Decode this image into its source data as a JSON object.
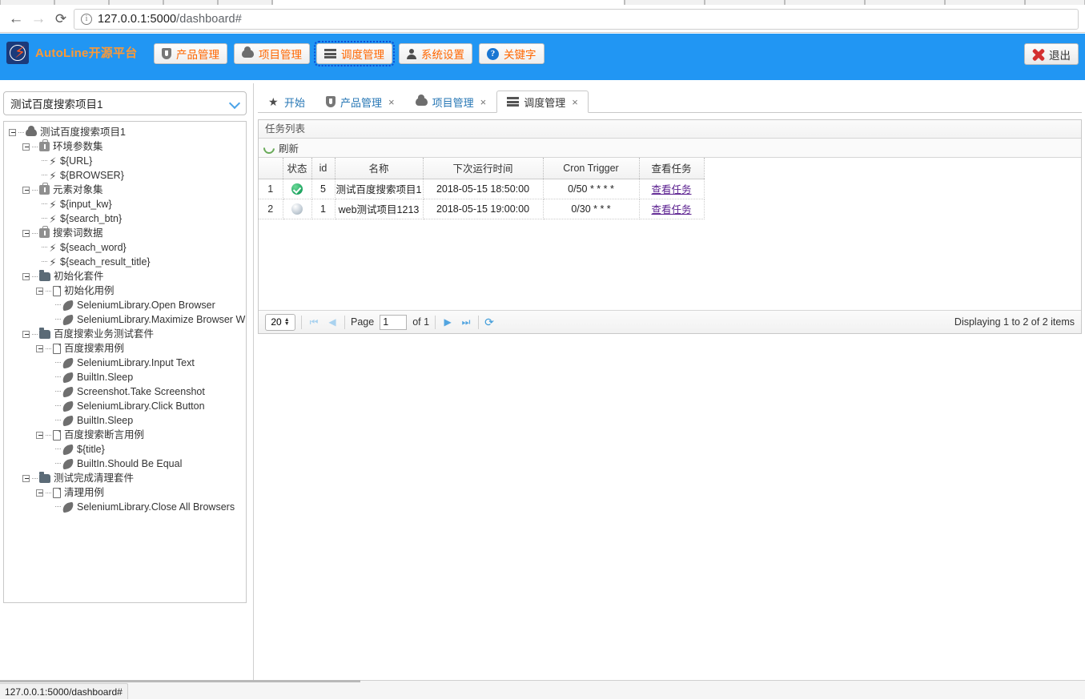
{
  "browser": {
    "back_icon": "arrow-left-icon",
    "forward_icon": "arrow-right-icon",
    "reload_icon": "reload-icon",
    "info_icon": "info-icon",
    "url_host": "127.0.0.1:5000",
    "url_path": "/dashboard#",
    "url_full": "127.0.0.1:5000/dashboard#"
  },
  "header": {
    "brand": "AutoLine开源平台",
    "logo_icon": "lightning-logo-icon",
    "nav": [
      {
        "label": "产品管理",
        "icon": "shield-icon",
        "active": false
      },
      {
        "label": "项目管理",
        "icon": "cloud-icon",
        "active": false
      },
      {
        "label": "调度管理",
        "icon": "lines-icon",
        "active": true
      },
      {
        "label": "系统设置",
        "icon": "user-icon",
        "active": false
      },
      {
        "label": "关键字",
        "icon": "help-icon",
        "active": false
      }
    ],
    "logout": {
      "label": "退出",
      "icon": "red-x-icon"
    }
  },
  "sidebar": {
    "project_select": {
      "value": "测试百度搜索项目1",
      "icon": "chevron-down-icon"
    },
    "tree": [
      {
        "label": "测试百度搜索项目1",
        "indent": 0,
        "icon": "cloud-icon",
        "toggle": true
      },
      {
        "label": "环境参数集",
        "indent": 1,
        "icon": "case-icon",
        "toggle": true
      },
      {
        "label": "${URL}",
        "indent": 2,
        "icon": "bolt-icon",
        "toggle": false
      },
      {
        "label": "${BROWSER}",
        "indent": 2,
        "icon": "bolt-icon",
        "toggle": false
      },
      {
        "label": "元素对象集",
        "indent": 1,
        "icon": "case-icon",
        "toggle": true
      },
      {
        "label": "${input_kw}",
        "indent": 2,
        "icon": "bolt-icon",
        "toggle": false
      },
      {
        "label": "${search_btn}",
        "indent": 2,
        "icon": "bolt-icon",
        "toggle": false
      },
      {
        "label": "搜索词数据",
        "indent": 1,
        "icon": "case-icon",
        "toggle": true
      },
      {
        "label": "${seach_word}",
        "indent": 2,
        "icon": "bolt-icon",
        "toggle": false
      },
      {
        "label": "${seach_result_title}",
        "indent": 2,
        "icon": "bolt-icon",
        "toggle": false
      },
      {
        "label": "初始化套件",
        "indent": 1,
        "icon": "folder-icon",
        "toggle": true
      },
      {
        "label": "初始化用例",
        "indent": 2,
        "icon": "file-icon",
        "toggle": true
      },
      {
        "label": "SeleniumLibrary.Open Browser",
        "indent": 3,
        "icon": "leaf-icon",
        "toggle": false
      },
      {
        "label": "SeleniumLibrary.Maximize Browser Wi",
        "indent": 3,
        "icon": "leaf-icon",
        "toggle": false
      },
      {
        "label": "百度搜索业务测试套件",
        "indent": 1,
        "icon": "folder-icon",
        "toggle": true
      },
      {
        "label": "百度搜索用例",
        "indent": 2,
        "icon": "file-icon",
        "toggle": true
      },
      {
        "label": "SeleniumLibrary.Input Text",
        "indent": 3,
        "icon": "leaf-icon",
        "toggle": false
      },
      {
        "label": "BuiltIn.Sleep",
        "indent": 3,
        "icon": "leaf-icon",
        "toggle": false
      },
      {
        "label": "Screenshot.Take Screenshot",
        "indent": 3,
        "icon": "leaf-icon",
        "toggle": false
      },
      {
        "label": "SeleniumLibrary.Click Button",
        "indent": 3,
        "icon": "leaf-icon",
        "toggle": false
      },
      {
        "label": "BuiltIn.Sleep",
        "indent": 3,
        "icon": "leaf-icon",
        "toggle": false
      },
      {
        "label": "百度搜索断言用例",
        "indent": 2,
        "icon": "file-icon",
        "toggle": true
      },
      {
        "label": "${title}",
        "indent": 3,
        "icon": "leaf-icon",
        "toggle": false
      },
      {
        "label": "BuiltIn.Should Be Equal",
        "indent": 3,
        "icon": "leaf-icon",
        "toggle": false
      },
      {
        "label": "测试完成清理套件",
        "indent": 1,
        "icon": "folder-icon",
        "toggle": true
      },
      {
        "label": "清理用例",
        "indent": 2,
        "icon": "file-icon",
        "toggle": true
      },
      {
        "label": "SeleniumLibrary.Close All Browsers",
        "indent": 3,
        "icon": "leaf-icon",
        "toggle": false
      }
    ]
  },
  "main": {
    "tabs": [
      {
        "label": "开始",
        "icon": "star-icon",
        "closable": false,
        "active": false
      },
      {
        "label": "产品管理",
        "icon": "shield-icon",
        "closable": true,
        "active": false
      },
      {
        "label": "项目管理",
        "icon": "cloud-icon",
        "closable": true,
        "active": false
      },
      {
        "label": "调度管理",
        "icon": "lines-icon",
        "closable": true,
        "active": true
      }
    ],
    "close_glyph": "×",
    "panel_title": "任务列表",
    "toolbar": {
      "refresh_label": "刷新",
      "refresh_icon": "refresh-icon"
    },
    "table": {
      "columns": [
        "",
        "状态",
        "id",
        "名称",
        "下次运行时间",
        "Cron Trigger",
        "查看任务"
      ],
      "rows": [
        {
          "index": "1",
          "status_icon": "status-ok-icon",
          "id": "5",
          "name": "测试百度搜索项目1",
          "next_run": "2018-05-15 18:50:00",
          "cron": "0/50 * * * *",
          "action": "查看任务"
        },
        {
          "index": "2",
          "status_icon": "status-idle-icon",
          "id": "1",
          "name": "web测试项目1213",
          "next_run": "2018-05-15 19:00:00",
          "cron": "0/30 * * *",
          "action": "查看任务"
        }
      ]
    },
    "pager": {
      "page_size": "20",
      "first_icon": "first-page-icon",
      "prev_icon": "prev-page-icon",
      "page_label": "Page",
      "page_value": "1",
      "of_label": "of 1",
      "next_icon": "next-page-icon",
      "last_icon": "last-page-icon",
      "reload_icon": "reload-icon",
      "count_text": "Displaying 1 to 2 of 2 items"
    }
  },
  "statusbar": {
    "text": "127.0.0.1:5000/dashboard#"
  }
}
